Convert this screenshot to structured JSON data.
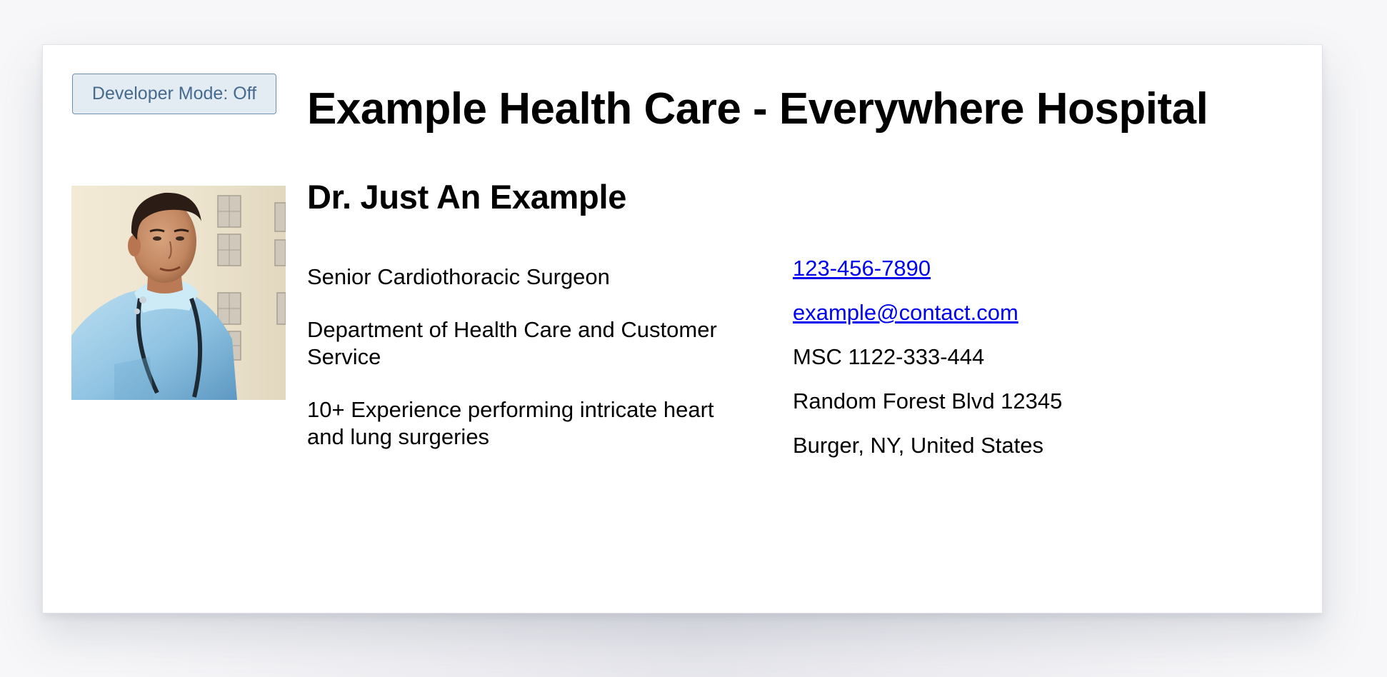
{
  "developer_mode": {
    "label": "Developer Mode: Off"
  },
  "header": {
    "title": "Example Health Care - Everywhere Hospital"
  },
  "profile": {
    "name": "Dr. Just An Example",
    "title": "Senior Cardiothoracic Surgeon",
    "department": "Department of Health Care and Customer Service",
    "experience": "10+ Experience performing intricate heart and lung surgeries"
  },
  "contact": {
    "phone": "123-456-7890",
    "email": "example@contact.com",
    "msc": "MSC 1122-333-444",
    "street": "Random Forest Blvd 12345",
    "city": "Burger, NY, United States"
  },
  "icons": {
    "portrait": "doctor-portrait-photo"
  },
  "colors": {
    "link": "#0000ee",
    "button_bg": "#e3ebf3",
    "button_border": "#6f8fae",
    "button_text": "#466a8d"
  }
}
